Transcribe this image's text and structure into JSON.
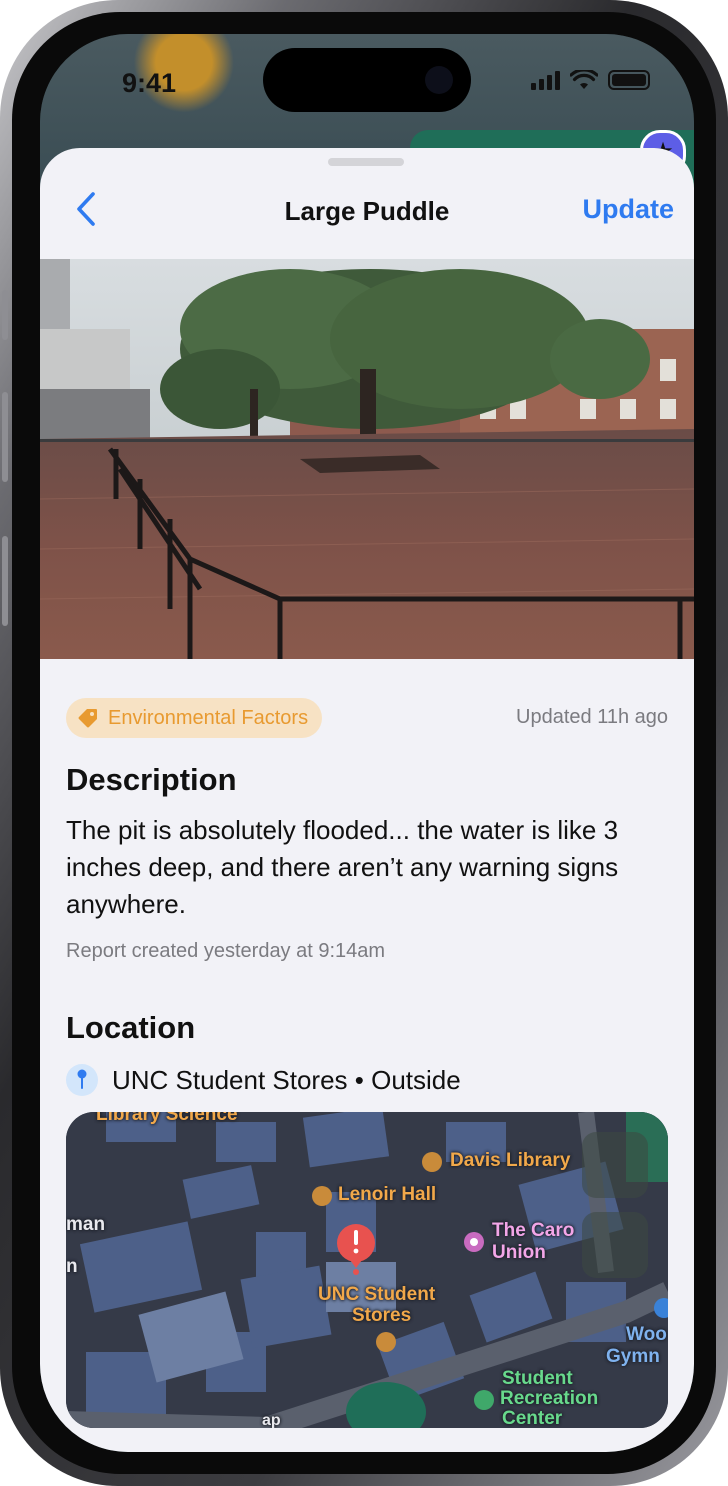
{
  "status": {
    "time": "9:41"
  },
  "nav": {
    "title": "Large Puddle",
    "update_label": "Update"
  },
  "report": {
    "category": "Environmental Factors",
    "updated": "Updated 11h ago",
    "description_heading": "Description",
    "description": "The pit is absolutely flooded... the water is like 3 inches deep, and there aren’t any warning signs anywhere.",
    "created": "Report created yesterday at 9:14am",
    "location_heading": "Location",
    "location": "UNC Student Stores • Outside"
  },
  "map": {
    "labels": {
      "library_science": "Library Science",
      "davis_library": "Davis Library",
      "lenoir_hall": "Lenoir Hall",
      "man": "man",
      "n": "n",
      "carolina_union_1": "The Caro",
      "carolina_union_2": "Union",
      "student_stores_1": "UNC Student",
      "student_stores_2": "Stores",
      "woollen_1": "Woo",
      "woollen_2": "Gymn",
      "src_1": "Student",
      "src_2": "Recreation",
      "src_3": "Center",
      "road": "ap"
    }
  },
  "colors": {
    "accent": "#2f7bf0",
    "tag_bg": "#f7e2c4",
    "tag_fg": "#e89a30",
    "sheet_bg": "#f2f2f7"
  }
}
